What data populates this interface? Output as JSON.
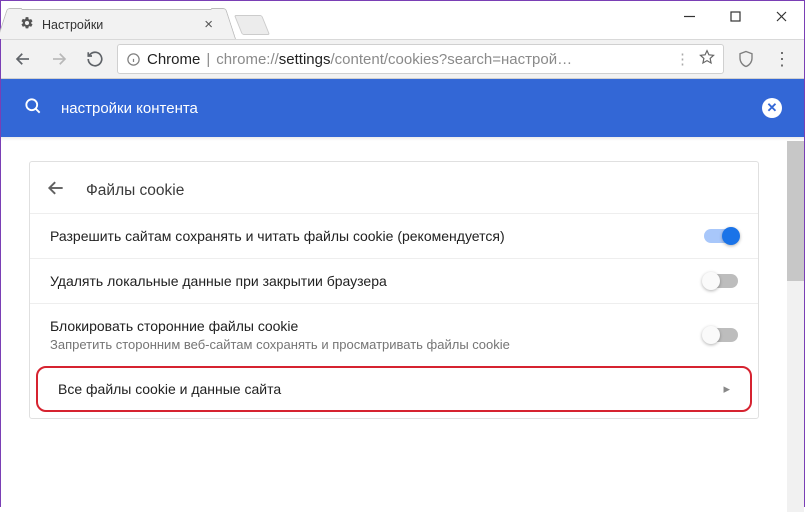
{
  "window": {
    "min": "–",
    "max": "☐",
    "close": "✕"
  },
  "tab": {
    "title": "Настройки"
  },
  "toolbar": {
    "secure_label": "Chrome",
    "url_prefix": "chrome://",
    "url_bold": "settings",
    "url_rest": "/content/cookies?search=настрой…"
  },
  "search": {
    "query": "настройки контента"
  },
  "page": {
    "header": "Файлы cookie",
    "rows": [
      {
        "title": "Разрешить сайтам сохранять и читать файлы cookie (рекомендуется)",
        "sub": "",
        "on": true
      },
      {
        "title": "Удалять локальные данные при закрытии браузера",
        "sub": "",
        "on": false
      },
      {
        "title": "Блокировать сторонние файлы cookie",
        "sub": "Запретить сторонним веб-сайтам сохранять и просматривать файлы cookie",
        "on": false
      }
    ],
    "link_row": "Все файлы cookie и данные сайта"
  }
}
